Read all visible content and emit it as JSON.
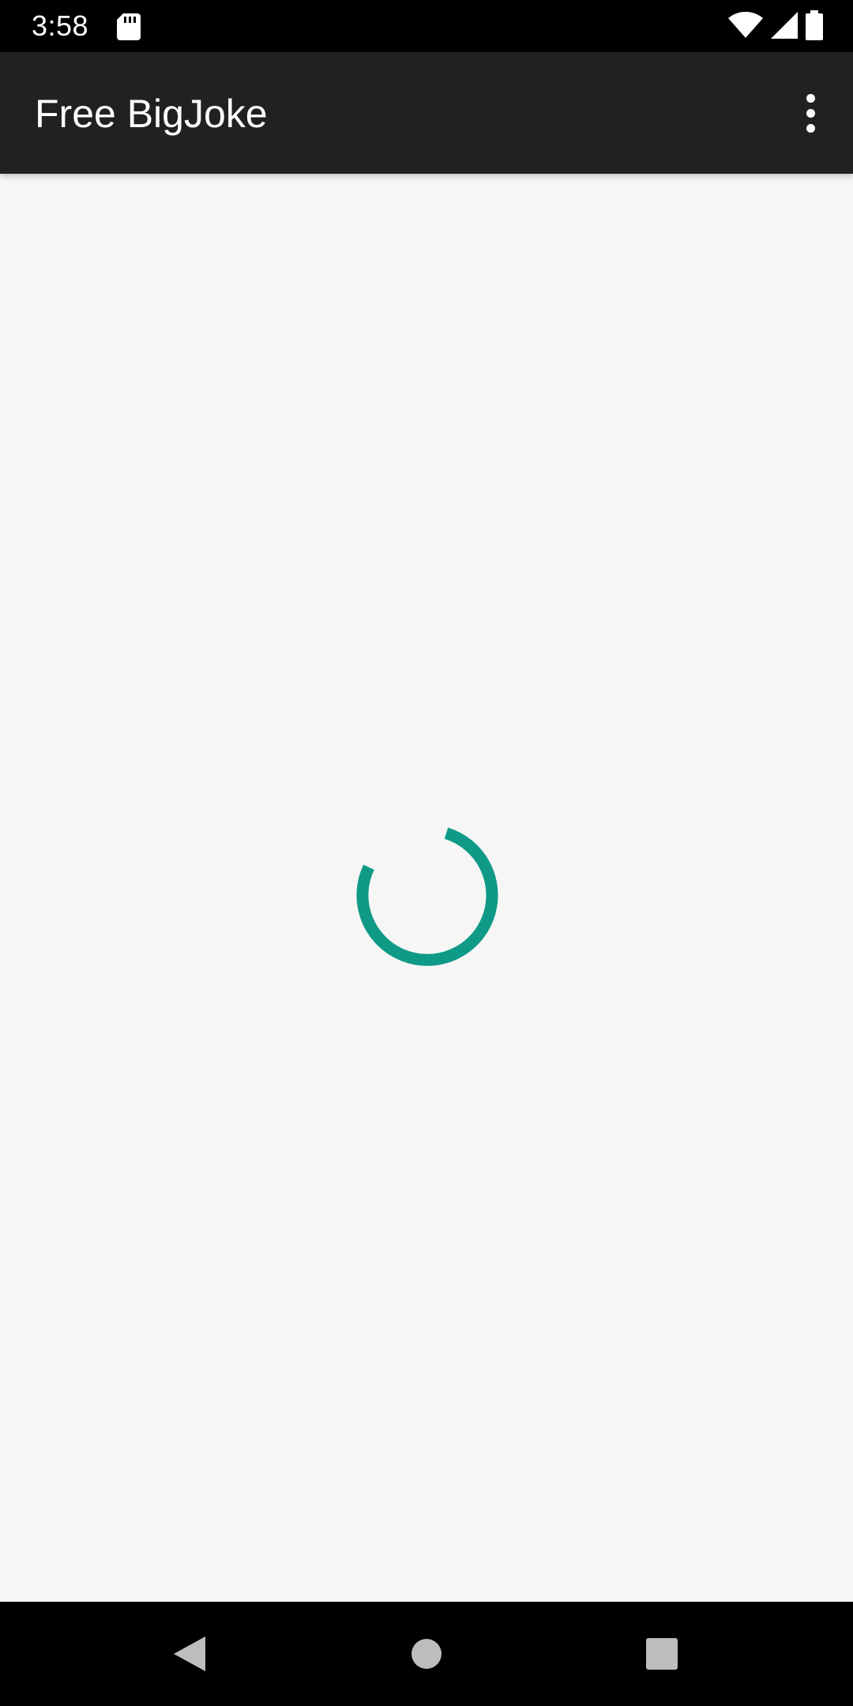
{
  "status_bar": {
    "time": "3:58",
    "icons": [
      "sd-card-icon",
      "wifi-icon",
      "cell-signal-icon",
      "battery-icon"
    ]
  },
  "app_bar": {
    "title": "Free BigJoke",
    "overflow_icon": "more-vert-icon"
  },
  "content": {
    "loading_indicator": "progress-spinner-icon"
  },
  "nav_bar": {
    "icons": [
      "back-icon",
      "home-icon",
      "recents-icon"
    ]
  },
  "colors": {
    "status_bar_bg": "#000000",
    "app_bar_bg": "#212121",
    "content_bg": "#f6f6f6",
    "accent": "#0f9a87",
    "nav_bar_bg": "#000000",
    "nav_icon": "#bdbdbd"
  }
}
